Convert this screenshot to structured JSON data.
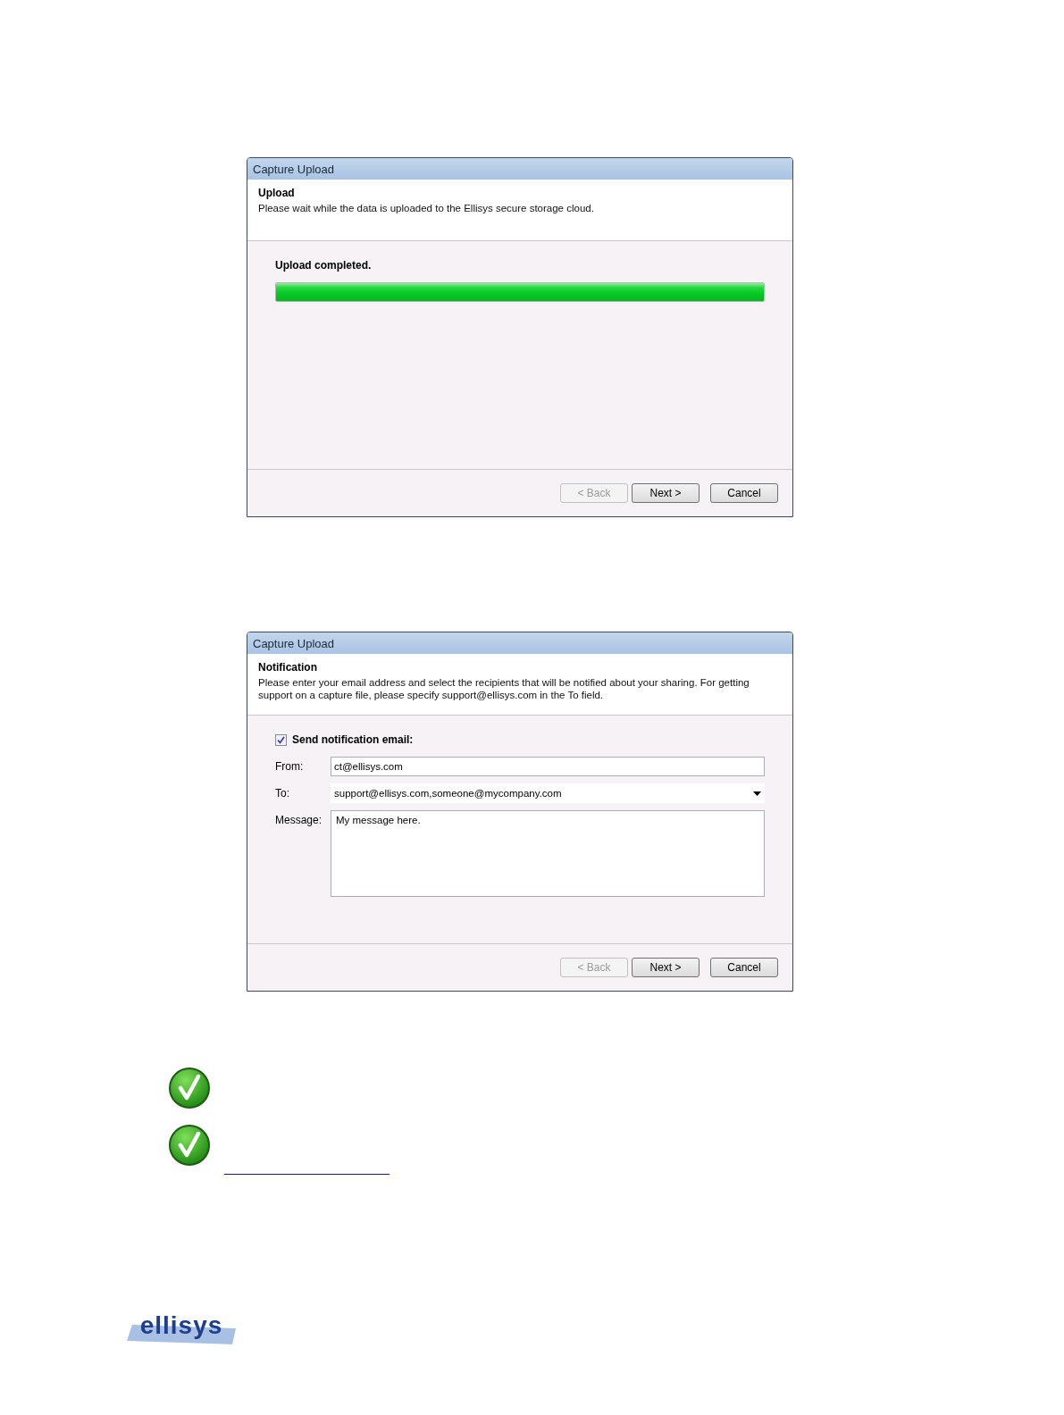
{
  "dialogs": [
    {
      "title": "Capture Upload",
      "heading": "Upload",
      "description": "Please wait while the data is uploaded to the Ellisys secure storage cloud.",
      "kind": "progress",
      "status": "Upload completed.",
      "level": 1,
      "buttons": [
        {
          "label": "< Back",
          "disabled": true
        },
        {
          "label": "Next >",
          "disabled": false
        },
        {
          "label": "Cancel",
          "disabled": false
        }
      ]
    },
    {
      "title": "Capture Upload",
      "heading": "Notification",
      "description": "Please enter your email address and select the recipients that will be notified about your sharing.  For getting support on a capture file, please specify support@ellisys.com in the To field.",
      "kind": "form",
      "checkbox": {
        "label": "Send notification email:",
        "checked": true
      },
      "fields": [
        {
          "label": "From:",
          "value": "ct@ellisys.com",
          "kind": "text"
        },
        {
          "label": "To:",
          "value": "support@ellisys.com,someone@mycompany.com",
          "kind": "dropdown"
        },
        {
          "label": "Message:",
          "value": "My message here.",
          "kind": "multiline"
        }
      ],
      "buttons": [
        {
          "label": "< Back",
          "disabled": true
        },
        {
          "label": "Next >",
          "disabled": false
        },
        {
          "label": "Cancel",
          "disabled": false
        }
      ]
    }
  ],
  "logo": {
    "text": "ellisys"
  }
}
